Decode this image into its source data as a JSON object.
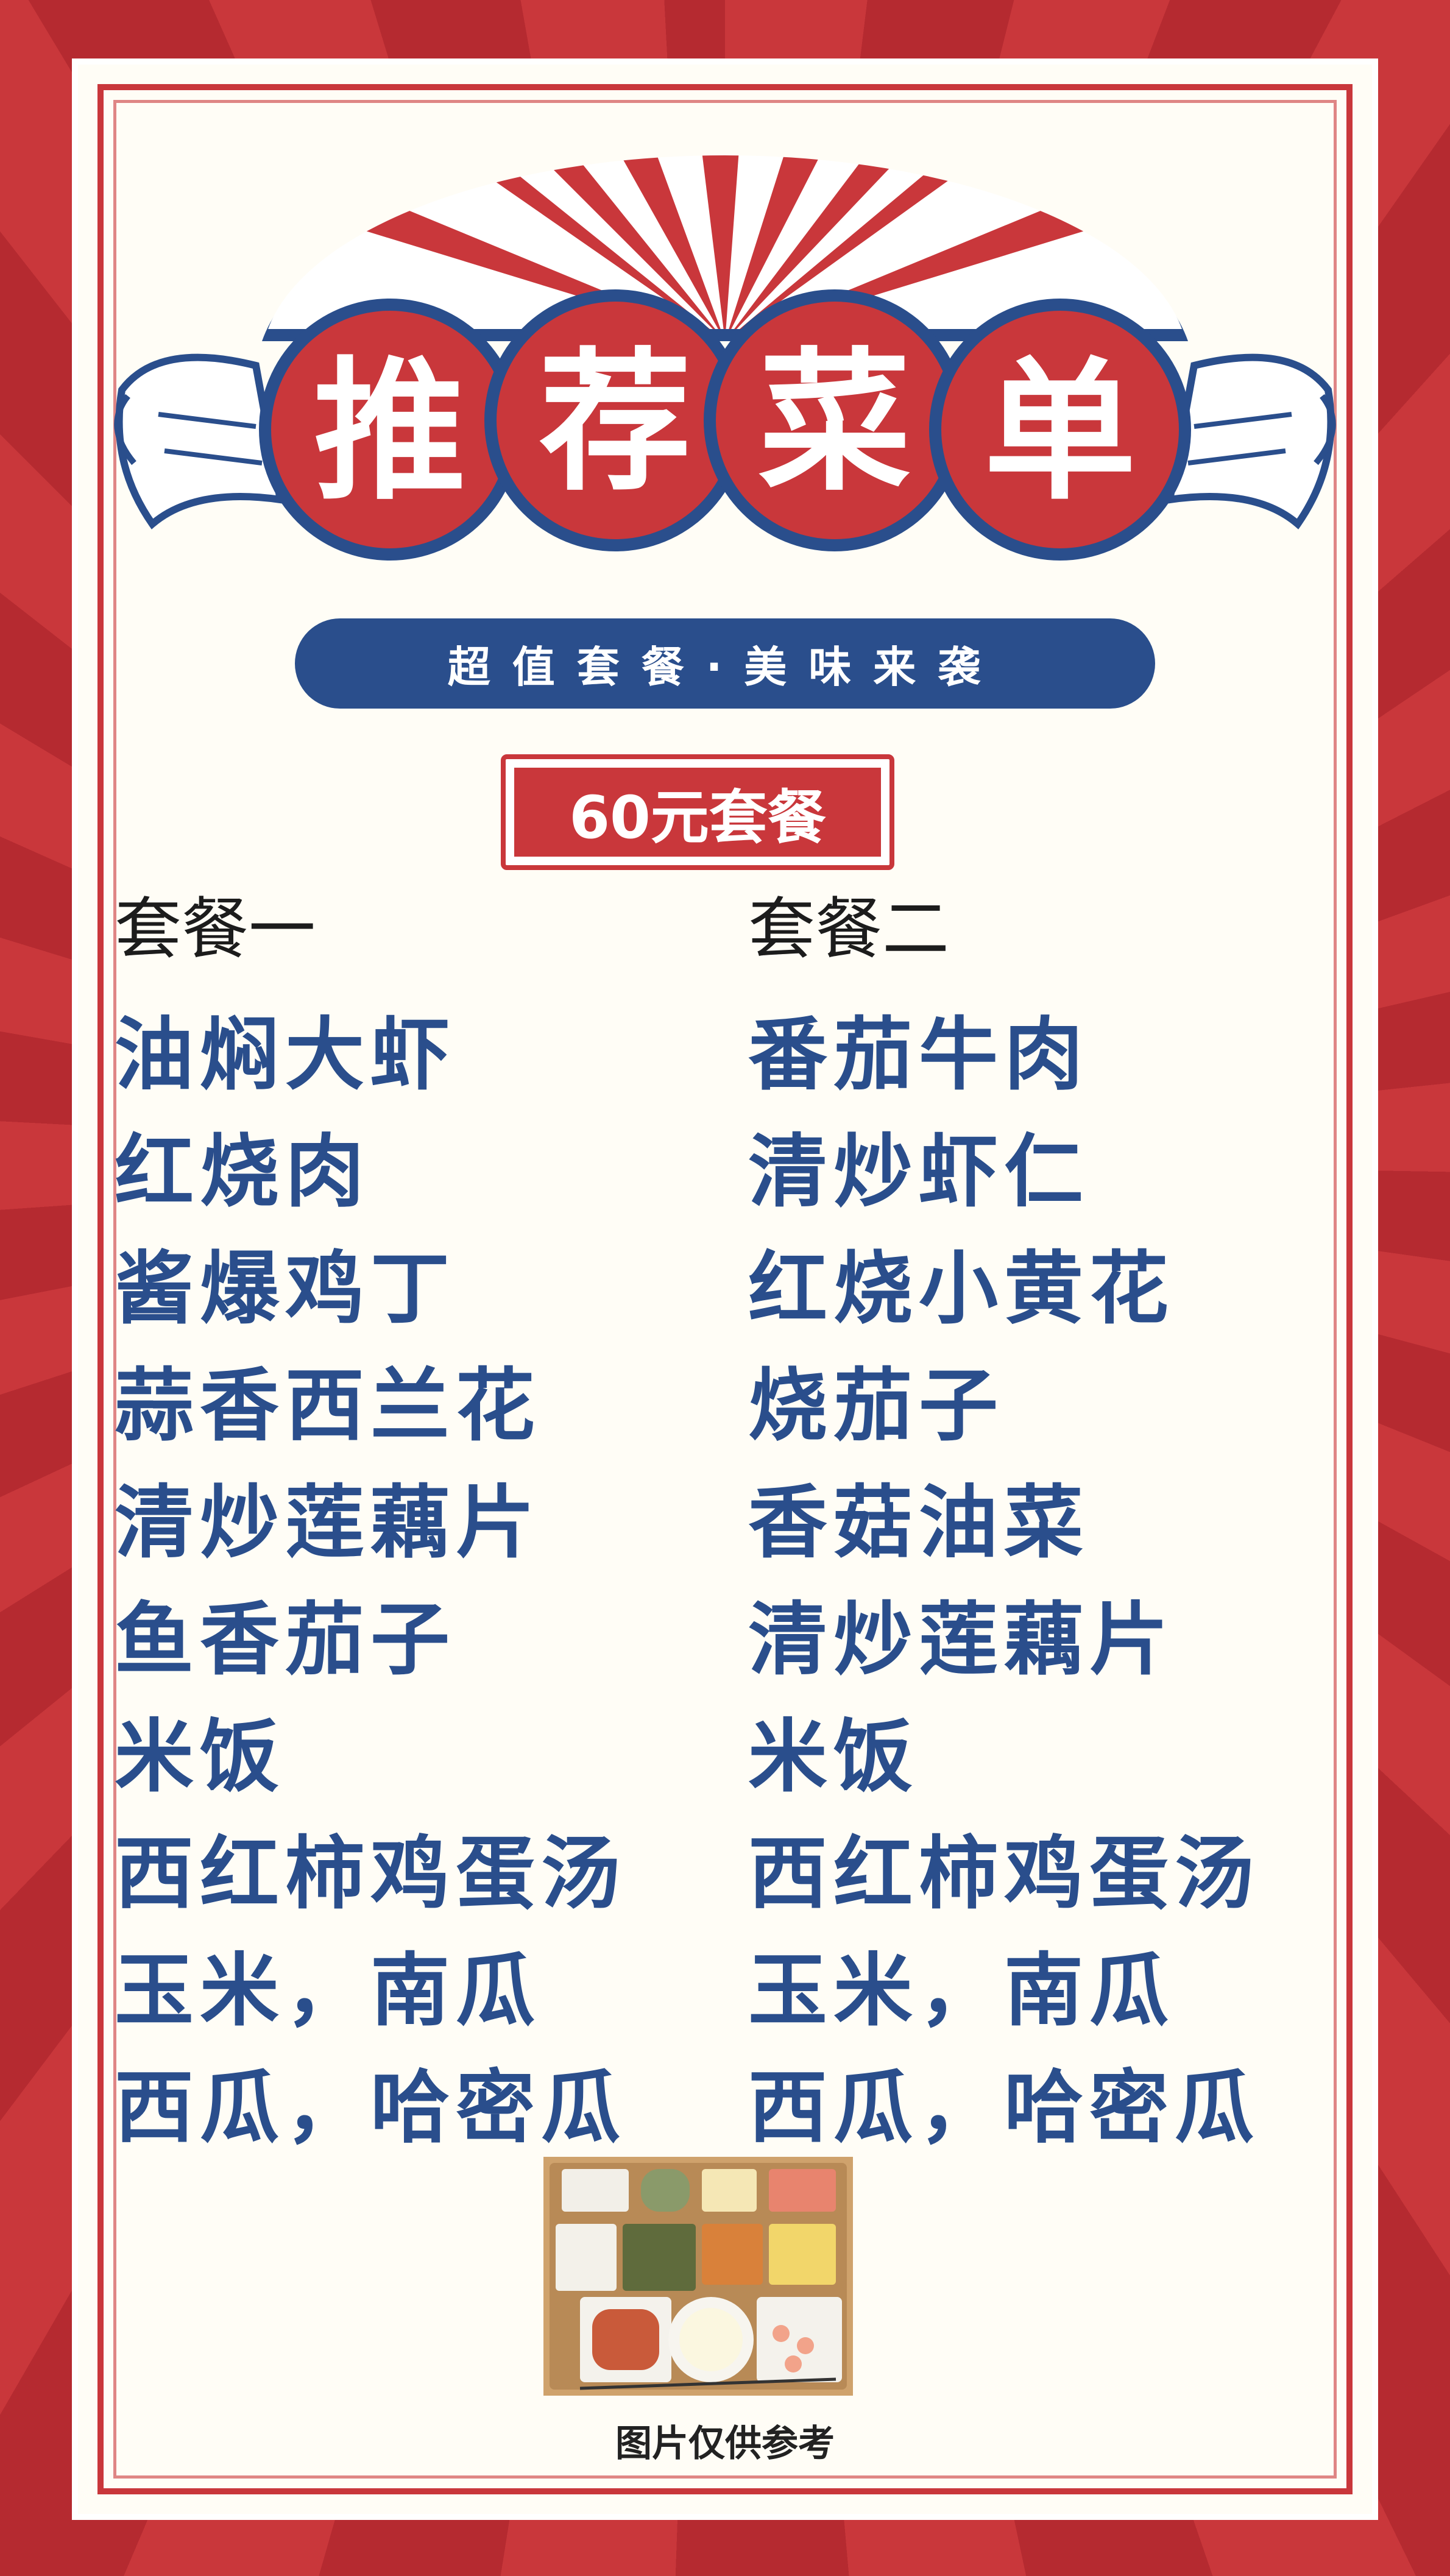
{
  "header": {
    "title_chars": [
      "推",
      "荐",
      "菜",
      "单"
    ],
    "subtitle": "超值套餐·美味来袭"
  },
  "price_tag": "60元套餐",
  "menus": [
    {
      "heading": "套餐一",
      "dishes": [
        "油焖大虾",
        "红烧肉",
        "酱爆鸡丁",
        "蒜香西兰花",
        "清炒莲藕片",
        "鱼香茄子",
        "米饭",
        "西红柿鸡蛋汤",
        "玉米，南瓜",
        "西瓜，哈密瓜"
      ]
    },
    {
      "heading": "套餐二",
      "dishes": [
        "番茄牛肉",
        "清炒虾仁",
        "红烧小黄花",
        "烧茄子",
        "香菇油菜",
        "清炒莲藕片",
        "米饭",
        "西红柿鸡蛋汤",
        "玉米，南瓜",
        "西瓜，哈密瓜"
      ]
    }
  ],
  "photo_caption": "图片仅供参考",
  "colors": {
    "red": "#c9373b",
    "blue": "#2a4e8c",
    "cream": "#fffdf6"
  }
}
